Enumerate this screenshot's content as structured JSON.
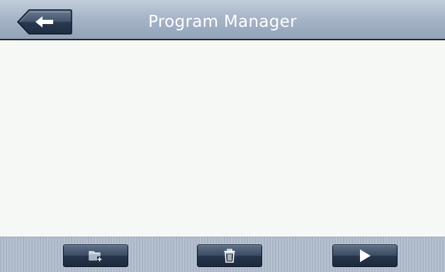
{
  "header": {
    "title": "Program Manager",
    "back_icon": "back-arrow-icon"
  },
  "content": {
    "items": []
  },
  "toolbar": {
    "buttons": [
      {
        "name": "add-folder-button",
        "icon": "folder-add-icon"
      },
      {
        "name": "delete-button",
        "icon": "trash-icon"
      },
      {
        "name": "run-button",
        "icon": "play-icon"
      }
    ]
  },
  "colors": {
    "header_top": "#c3cedc",
    "header_bottom": "#92a3b8",
    "content_bg": "#f5f8f4",
    "button_dark": "#1d2a3e",
    "button_light": "#5e6f87"
  }
}
